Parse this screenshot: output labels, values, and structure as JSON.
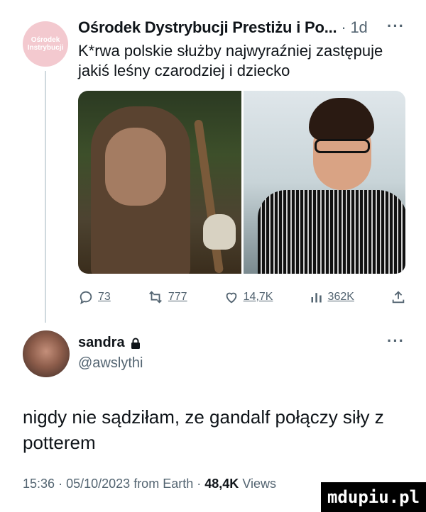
{
  "quoted_post": {
    "avatar_text": "Ośrodek Instrybucji",
    "author": "Ośrodek Dystrybucji Prestiżu i Po...",
    "separator": "·",
    "time": "1d",
    "more": "···",
    "text": "K*rwa polskie służby najwyraźniej zastępuje jakiś leśny czarodziej i dziecko",
    "actions": {
      "replies": "73",
      "reposts": "777",
      "likes": "14,7K",
      "views": "362K"
    }
  },
  "main_post": {
    "name": "sandra",
    "handle": "@awslythi",
    "more": "···",
    "text": "nigdy nie sądziłam, ze gandalf połączy siły z potterem",
    "meta": {
      "time": "15:36",
      "sep1": "·",
      "date": "05/10/2023",
      "source": "from Earth",
      "sep2": "·",
      "views": "48,4K",
      "views_label": "Views"
    }
  },
  "watermark": "mdupiu.pl",
  "colors": {
    "text": "#0f1419",
    "secondary": "#536471",
    "line": "#cfd9de"
  },
  "icons": [
    "reply-icon",
    "repost-icon",
    "like-icon",
    "views-icon",
    "share-icon",
    "lock-icon"
  ]
}
